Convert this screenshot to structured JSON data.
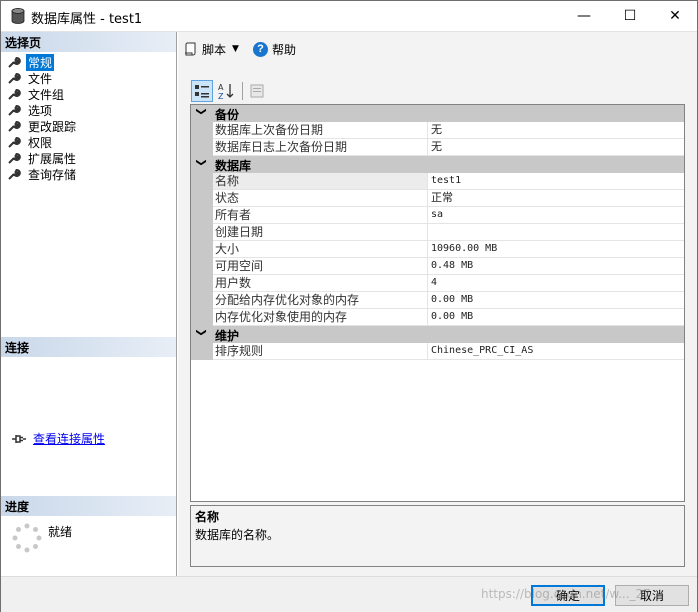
{
  "window": {
    "title": "数据库属性 - test1",
    "controls": {
      "minimize": "—",
      "maximize": "☐",
      "close": "✕"
    }
  },
  "left_panel": {
    "select_page_header": "选择页",
    "pages": [
      {
        "label": "常规",
        "selected": true
      },
      {
        "label": "文件",
        "selected": false
      },
      {
        "label": "文件组",
        "selected": false
      },
      {
        "label": "选项",
        "selected": false
      },
      {
        "label": "更改跟踪",
        "selected": false
      },
      {
        "label": "权限",
        "selected": false
      },
      {
        "label": "扩展属性",
        "selected": false
      },
      {
        "label": "查询存储",
        "selected": false
      }
    ],
    "connection_header": "连接",
    "view_connection_link": "查看连接属性",
    "progress_header": "进度",
    "progress_status": "就绪"
  },
  "toolbar": {
    "script_label": "脚本",
    "help_label": "帮助"
  },
  "property_grid": {
    "categories": [
      {
        "name": "备份",
        "rows": [
          {
            "name": "数据库上次备份日期",
            "value": "无"
          },
          {
            "name": "数据库日志上次备份日期",
            "value": "无"
          }
        ]
      },
      {
        "name": "数据库",
        "rows": [
          {
            "name": "名称",
            "value": "test1"
          },
          {
            "name": "状态",
            "value": "正常"
          },
          {
            "name": "所有者",
            "value": "sa"
          },
          {
            "name": "创建日期",
            "value": ""
          },
          {
            "name": "大小",
            "value": "10960.00 MB"
          },
          {
            "name": "可用空间",
            "value": "0.48 MB"
          },
          {
            "name": "用户数",
            "value": "4"
          },
          {
            "name": "分配给内存优化对象的内存",
            "value": "0.00 MB"
          },
          {
            "name": "内存优化对象使用的内存",
            "value": "0.00 MB"
          }
        ]
      },
      {
        "name": "维护",
        "rows": [
          {
            "name": "排序规则",
            "value": "Chinese_PRC_CI_AS"
          }
        ]
      }
    ]
  },
  "description": {
    "title": "名称",
    "text": "数据库的名称。"
  },
  "buttons": {
    "ok": "确定",
    "cancel": "取消"
  },
  "watermark": "https://blog.csdn.net/w..._27",
  "colors": {
    "selection": "#0078d7",
    "category_bg": "#c8c8c8",
    "link": "#0000ee"
  }
}
